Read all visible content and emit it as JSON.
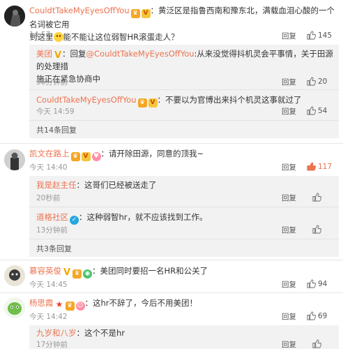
{
  "comments": [
    {
      "user": "CouldtTakeMyEyesOffYou",
      "text_1": "：黄泛区是指鲁西南和豫东北，满载血泪心酸的一个名词被它用",
      "text_2a": "到这里",
      "text_2b": "能不能让这位弱智HR滚蛋走人？",
      "time": "14:57",
      "reply_label": "回复",
      "likes": "145",
      "replies": [
        {
          "user": "美团",
          "prefix": "：回复",
          "mention": "@CouldtTakeMyEyesOffYou",
          "text_1": ":从来没觉得抖机灵会平事情，关于田源的处理措",
          "text_2": "施正在紧急协商中",
          "time": "56分钟前",
          "reply_label": "回复",
          "likes": "20"
        },
        {
          "user": "CouldtTakeMyEyesOffYou",
          "text": "：不要以为官博出来抖个机灵这事就过了",
          "time": "今天 14:59",
          "reply_label": "回复",
          "likes": "54"
        }
      ],
      "more_replies": "共14条回复"
    },
    {
      "user": "凯文在路上",
      "text": "：请开除田源，同意的顶我~",
      "time": "今天 14:40",
      "reply_label": "回复",
      "likes": "117",
      "replies": [
        {
          "user": "我是赵主任",
          "text": "：这哥们已经被送走了",
          "time": "20秒前",
          "reply_label": "回复"
        },
        {
          "user": "道格社区",
          "text": "：这种弱智hr，就不应该找到工作。",
          "time": "13分钟前",
          "reply_label": "回复"
        }
      ],
      "more_replies": "共3条回复"
    },
    {
      "user": "慕容英俊",
      "text": "：美团同时要招一名HR和公关了",
      "time": "今天 14:45",
      "reply_label": "回复",
      "likes": "94"
    },
    {
      "user": "杨思霞",
      "text": "：这hr不辞了，今后不用美团！",
      "time": "今天 14:42",
      "reply_label": "回复",
      "likes": "69",
      "replies": [
        {
          "user": "九岁和八岁",
          "text": "：这个不是hr",
          "time": "17分钟前",
          "reply_label": "回复"
        }
      ]
    }
  ],
  "icons": {
    "like": "thumbs-up-icon",
    "hot_like": "thumbs-up-hot-icon"
  },
  "colors": {
    "username": "#eb7350",
    "hot_like": "#eb7350",
    "reply_bg": "#f2f2f2"
  }
}
